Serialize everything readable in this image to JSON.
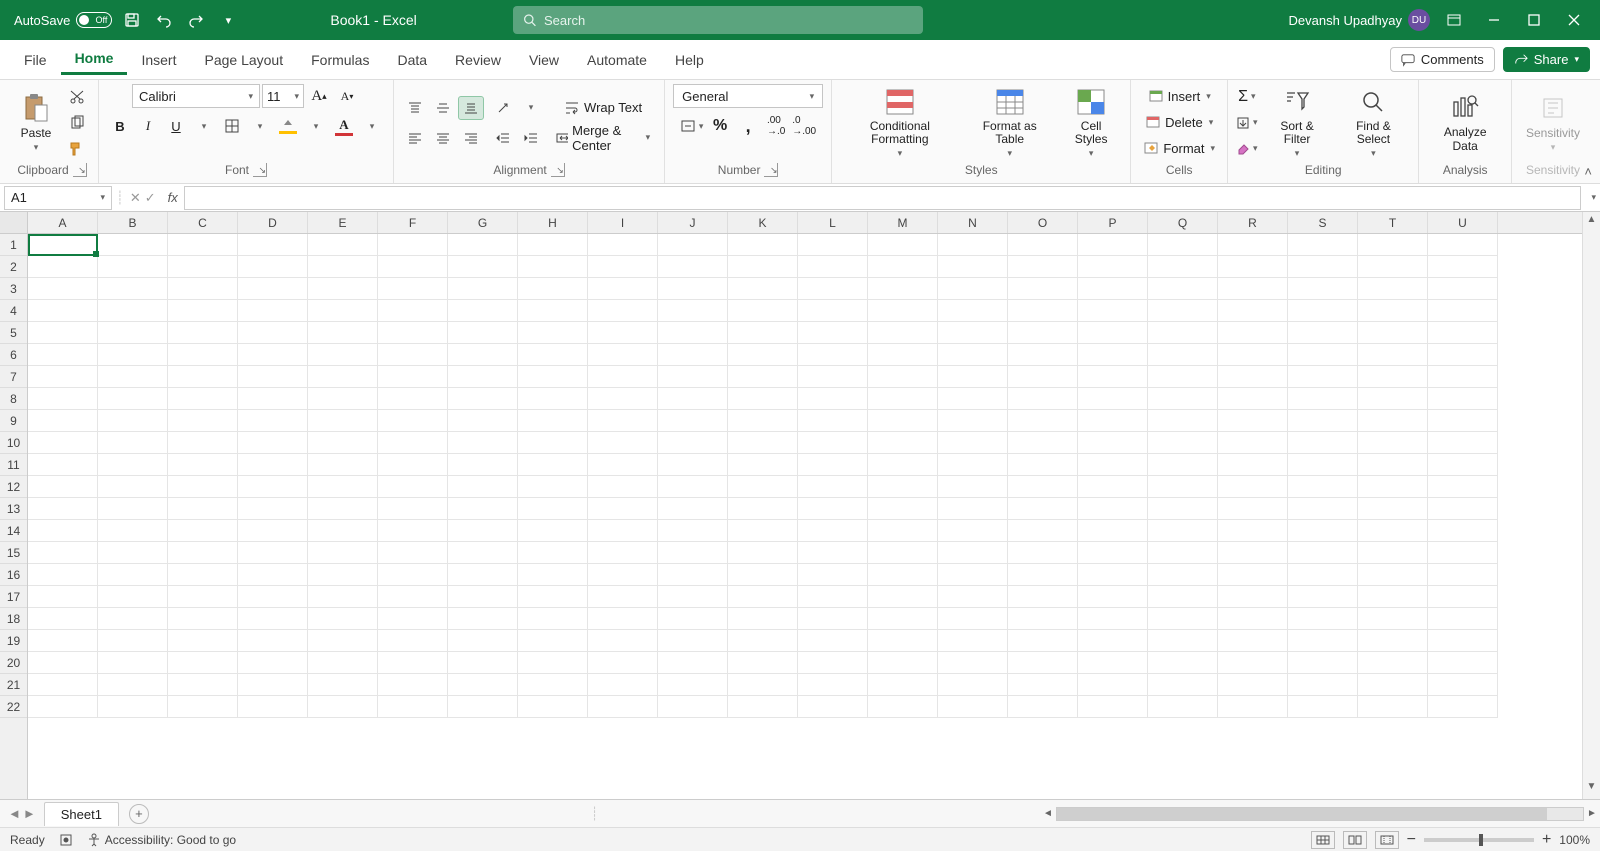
{
  "titlebar": {
    "autosave_label": "AutoSave",
    "autosave_state": "Off",
    "doc_title": "Book1 - Excel",
    "search_placeholder": "Search",
    "user_name": "Devansh Upadhyay",
    "user_initials": "DU"
  },
  "tabs": {
    "items": [
      "File",
      "Home",
      "Insert",
      "Page Layout",
      "Formulas",
      "Data",
      "Review",
      "View",
      "Automate",
      "Help"
    ],
    "active": "Home",
    "comments": "Comments",
    "share": "Share"
  },
  "ribbon": {
    "clipboard": {
      "paste": "Paste",
      "label": "Clipboard"
    },
    "font": {
      "name": "Calibri",
      "size": "11",
      "label": "Font"
    },
    "alignment": {
      "wrap": "Wrap Text",
      "merge": "Merge & Center",
      "label": "Alignment"
    },
    "number": {
      "format": "General",
      "label": "Number"
    },
    "styles": {
      "cond": "Conditional Formatting",
      "fat": "Format as Table",
      "cell": "Cell Styles",
      "label": "Styles"
    },
    "cells": {
      "insert": "Insert",
      "delete": "Delete",
      "format": "Format",
      "label": "Cells"
    },
    "editing": {
      "sort": "Sort & Filter",
      "find": "Find & Select",
      "label": "Editing"
    },
    "analysis": {
      "analyze": "Analyze Data",
      "label": "Analysis"
    },
    "sensitivity": {
      "btn": "Sensitivity",
      "label": "Sensitivity"
    }
  },
  "formula": {
    "namebox": "A1"
  },
  "grid": {
    "cols": [
      "A",
      "B",
      "C",
      "D",
      "E",
      "F",
      "G",
      "H",
      "I",
      "J",
      "K",
      "L",
      "M",
      "N",
      "O",
      "P",
      "Q",
      "R",
      "S",
      "T",
      "U"
    ],
    "rows": 22,
    "active_cell": "A1"
  },
  "sheets": {
    "active": "Sheet1"
  },
  "status": {
    "ready": "Ready",
    "accessibility": "Accessibility: Good to go",
    "zoom": "100%"
  }
}
